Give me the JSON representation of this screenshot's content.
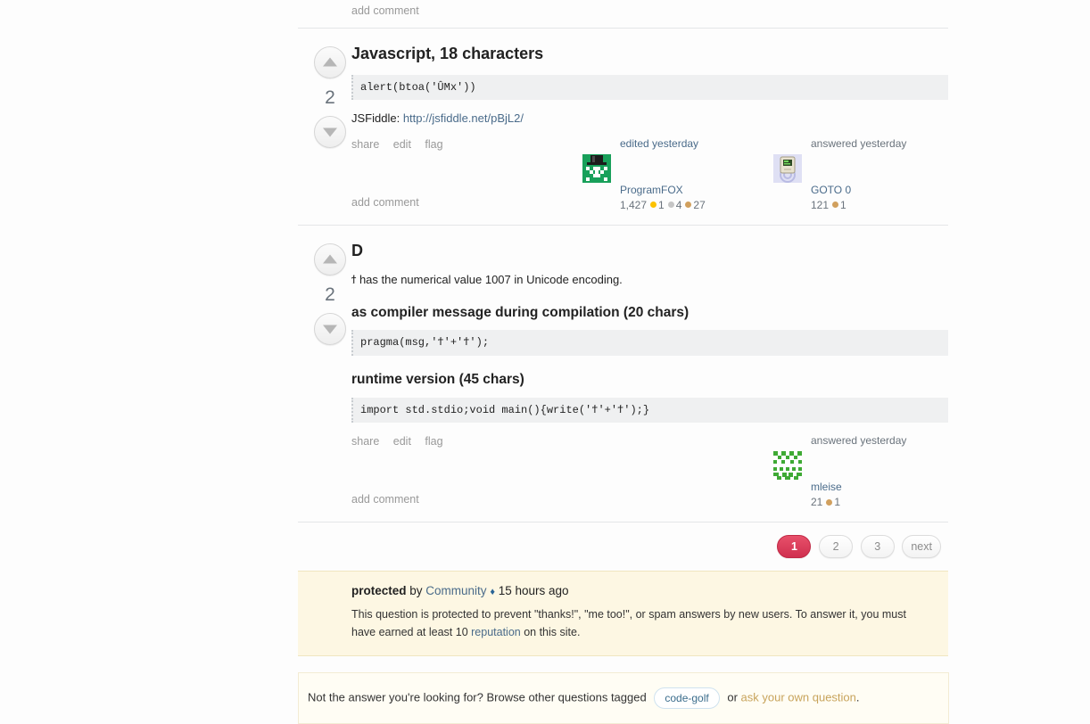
{
  "top_comment": {
    "add_comment_label": "add comment"
  },
  "answers": [
    {
      "id": "javascript",
      "votes": "2",
      "title": "Javascript, 18 characters",
      "code": "alert(btoa('ÛMx'))",
      "link_prefix": "JSFiddle: ",
      "link_text": "http://jsfiddle.net/pBjL2/",
      "menu": {
        "share": "share",
        "edit": "edit",
        "flag": "flag"
      },
      "add_comment_label": "add comment",
      "user_cards": [
        {
          "action": "edited yesterday",
          "action_kind": "edited",
          "name": "ProgramFOX",
          "reputation": "1,427",
          "badges": [
            {
              "type": "gold",
              "count": "1"
            },
            {
              "type": "silver",
              "count": "4"
            },
            {
              "type": "bronze",
              "count": "27"
            }
          ],
          "avatar": "tophat-identicon-avatar"
        },
        {
          "action": "answered yesterday",
          "action_kind": "answered",
          "name": "GOTO 0",
          "reputation": "121",
          "badges": [
            {
              "type": "bronze",
              "count": "1"
            }
          ],
          "avatar": "macintosh-avatar"
        }
      ]
    },
    {
      "id": "d-lang",
      "votes": "2",
      "title": "D",
      "paragraph": "ϯ has the numerical value 1007 in Unicode encoding.",
      "section1_title": "as compiler message during compilation (20 chars)",
      "section1_code": "pragma(msg,'ϯ'+'ϯ');",
      "section2_title": "runtime version (45 chars)",
      "section2_code": "import std.stdio;void main(){write('ϯ'+'ϯ');}",
      "menu": {
        "share": "share",
        "edit": "edit",
        "flag": "flag"
      },
      "add_comment_label": "add comment",
      "user_cards": [
        {
          "action": "answered yesterday",
          "action_kind": "answered",
          "name": "mleise",
          "reputation": "21",
          "badges": [
            {
              "type": "bronze",
              "count": "1"
            }
          ],
          "avatar": "green-identicon-avatar"
        }
      ]
    }
  ],
  "pagination": {
    "pages": [
      "1",
      "2",
      "3"
    ],
    "current": "1",
    "next_label": "next"
  },
  "protected_notice": {
    "title_strong": "protected",
    "title_by": " by ",
    "community_link": "Community",
    "diamond": "♦",
    "timestamp": " 15 hours ago",
    "body_part1": "This question is protected to prevent \"thanks!\", \"me too!\", or spam answers by new users. To answer it, you must have earned at least 10 ",
    "reputation_link": "reputation",
    "body_part2": " on this site."
  },
  "bottom_bar": {
    "text_before": "Not the answer you're looking for? Browse other questions tagged",
    "tag": "code-golf",
    "text_or": "or",
    "ask_link": "ask your own question",
    "period": "."
  },
  "colors": {
    "link": "#4a6b8a",
    "muted": "#999999",
    "code_bg": "#eff0f1",
    "notice_bg": "#fdf7e3",
    "bottom_bg": "#fffdf4",
    "pager_current": "#d0304f",
    "badge_gold": "#fcc200",
    "badge_silver": "#c5c5c5",
    "badge_bronze": "#d1a05e",
    "tag_text": "#3b6d8c",
    "ask_link": "#c8a45c"
  }
}
